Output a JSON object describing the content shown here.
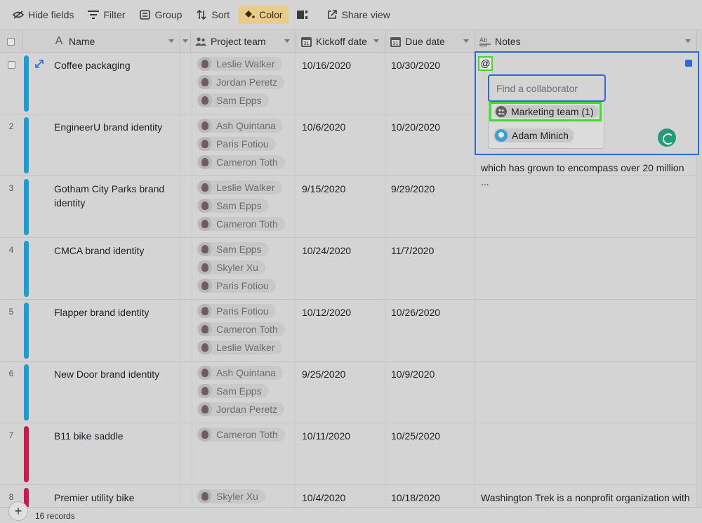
{
  "toolbar": {
    "hide_fields": "Hide fields",
    "filter": "Filter",
    "group": "Group",
    "sort": "Sort",
    "color": "Color",
    "share_view": "Share view"
  },
  "columns": {
    "name": "Name",
    "project_team": "Project team",
    "kickoff": "Kickoff date",
    "due": "Due date",
    "notes": "Notes"
  },
  "rows": [
    {
      "num": "",
      "name": "Coffee packaging",
      "team": [
        "Leslie Walker",
        "Jordan Peretz",
        "Sam Epps"
      ],
      "kickoff": "10/16/2020",
      "due": "10/30/2020",
      "color": "#1a9ed4"
    },
    {
      "num": "2",
      "name": "EngineerU brand identity",
      "team": [
        "Ash Quintana",
        "Paris Fotiou",
        "Cameron Toth"
      ],
      "kickoff": "10/6/2020",
      "due": "10/20/2020",
      "color": "#1a9ed4"
    },
    {
      "num": "3",
      "name": "Gotham City Parks brand identity",
      "team": [
        "Leslie Walker",
        "Sam Epps",
        "Cameron Toth"
      ],
      "kickoff": "9/15/2020",
      "due": "9/29/2020",
      "color": "#1a9ed4"
    },
    {
      "num": "4",
      "name": "CMCA brand identity",
      "team": [
        "Sam Epps",
        "Skyler Xu",
        "Paris Fotiou"
      ],
      "kickoff": "10/24/2020",
      "due": "11/7/2020",
      "color": "#1a9ed4"
    },
    {
      "num": "5",
      "name": "Flapper brand identity",
      "team": [
        "Paris Fotiou",
        "Cameron Toth",
        "Leslie Walker"
      ],
      "kickoff": "10/12/2020",
      "due": "10/26/2020",
      "color": "#1a9ed4"
    },
    {
      "num": "6",
      "name": "New Door brand identity",
      "team": [
        "Ash Quintana",
        "Sam Epps",
        "Jordan Peretz"
      ],
      "kickoff": "9/25/2020",
      "due": "10/9/2020",
      "color": "#1a9ed4"
    },
    {
      "num": "7",
      "name": "B11 bike saddle",
      "team": [
        "Cameron Toth"
      ],
      "kickoff": "10/11/2020",
      "due": "10/25/2020",
      "color": "#d0174f"
    },
    {
      "num": "8",
      "name": "Premier utility bike",
      "team": [
        "Skyler Xu"
      ],
      "kickoff": "10/4/2020",
      "due": "10/18/2020",
      "color": "#d0174f"
    }
  ],
  "notes_editor": {
    "at_symbol": "@",
    "find_placeholder": "Find a collaborator",
    "team_option": "Marketing team (1)",
    "user_option": "Adam Minich",
    "row2_notes": "which has grown to encompass over 20 million ...",
    "row8_notes": "Washington Trek is a nonprofit organization with"
  },
  "footer": {
    "records": "16 records",
    "add": "+"
  }
}
